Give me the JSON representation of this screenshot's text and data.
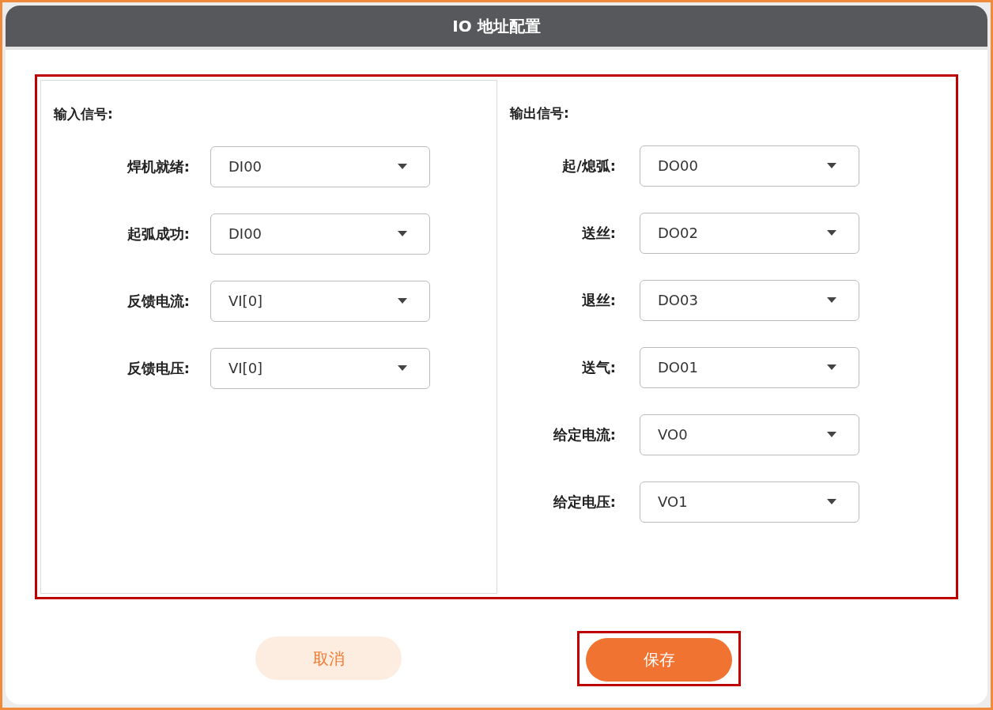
{
  "dialog": {
    "title": "IO 地址配置"
  },
  "panels": [
    {
      "heading": "输入信号:",
      "fields": [
        {
          "label": "焊机就绪:",
          "value": "DI00"
        },
        {
          "label": "起弧成功:",
          "value": "DI00"
        },
        {
          "label": "反馈电流:",
          "value": "VI[0]"
        },
        {
          "label": "反馈电压:",
          "value": "VI[0]"
        }
      ]
    },
    {
      "heading": "输出信号:",
      "fields": [
        {
          "label": "起/熄弧:",
          "value": "DO00"
        },
        {
          "label": "送丝:",
          "value": "DO02"
        },
        {
          "label": "退丝:",
          "value": "DO03"
        },
        {
          "label": "送气:",
          "value": "DO01"
        },
        {
          "label": "给定电流:",
          "value": "VO0"
        },
        {
          "label": "给定电压:",
          "value": "VO1"
        }
      ]
    }
  ],
  "buttons": [
    {
      "label": "取消",
      "kind": "secondary"
    },
    {
      "label": "保存",
      "kind": "primary"
    }
  ]
}
